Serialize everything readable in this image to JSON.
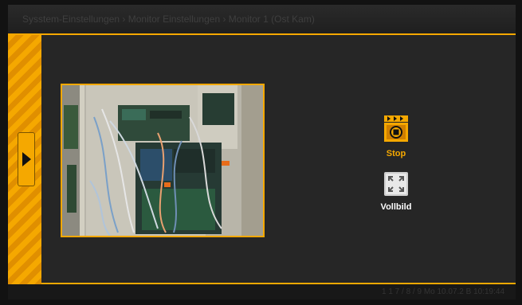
{
  "window": {
    "title": "Sysstem-Einstellungen › Monitor Einstellungen › Monitor 1 (Ost Kam)"
  },
  "controls": {
    "stop": {
      "label": "Stop",
      "icon": "stop-clapper-icon"
    },
    "fullscreen": {
      "label": "Vollbild",
      "icon": "fullscreen-icon"
    }
  },
  "status": {
    "text": "1       1   7 / 8 / 9        Mo 10.07.2 B 10:19:44"
  },
  "colors": {
    "accent": "#f5a800",
    "background": "#262626",
    "label_active": "#f5a800",
    "label_default": "#ffffff"
  }
}
